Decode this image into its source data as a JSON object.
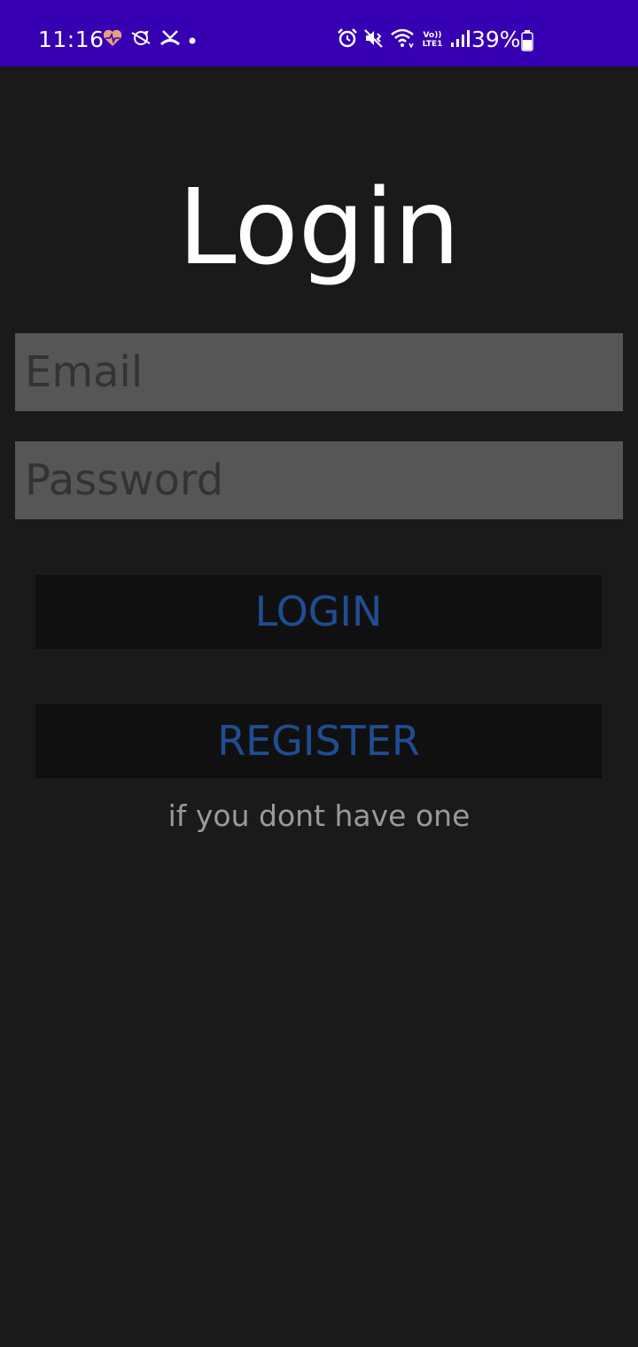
{
  "status_bar": {
    "time": "11:16",
    "battery": "39%",
    "network_label": "Vo)) LTE1",
    "bg_color": "#3700b3",
    "left_icons": [
      "heart-rate-icon",
      "sync-icon",
      "missed-call-icon",
      "dot-icon"
    ],
    "right_icons": [
      "alarm-icon",
      "mute-vibrate-icon",
      "wifi-icon",
      "volte-lte-icon",
      "signal-icon",
      "battery-icon"
    ]
  },
  "screen": {
    "title": "Login",
    "email_placeholder": "Email",
    "password_placeholder": "Password",
    "login_label": "LOGIN",
    "register_label": "REGISTER",
    "register_hint": "if you dont have one"
  },
  "colors": {
    "background": "#1b1a1b",
    "field_bg": "#575657",
    "button_bg": "#111011",
    "button_text": "#1f4d91",
    "hint_text": "#9a9a9a"
  }
}
